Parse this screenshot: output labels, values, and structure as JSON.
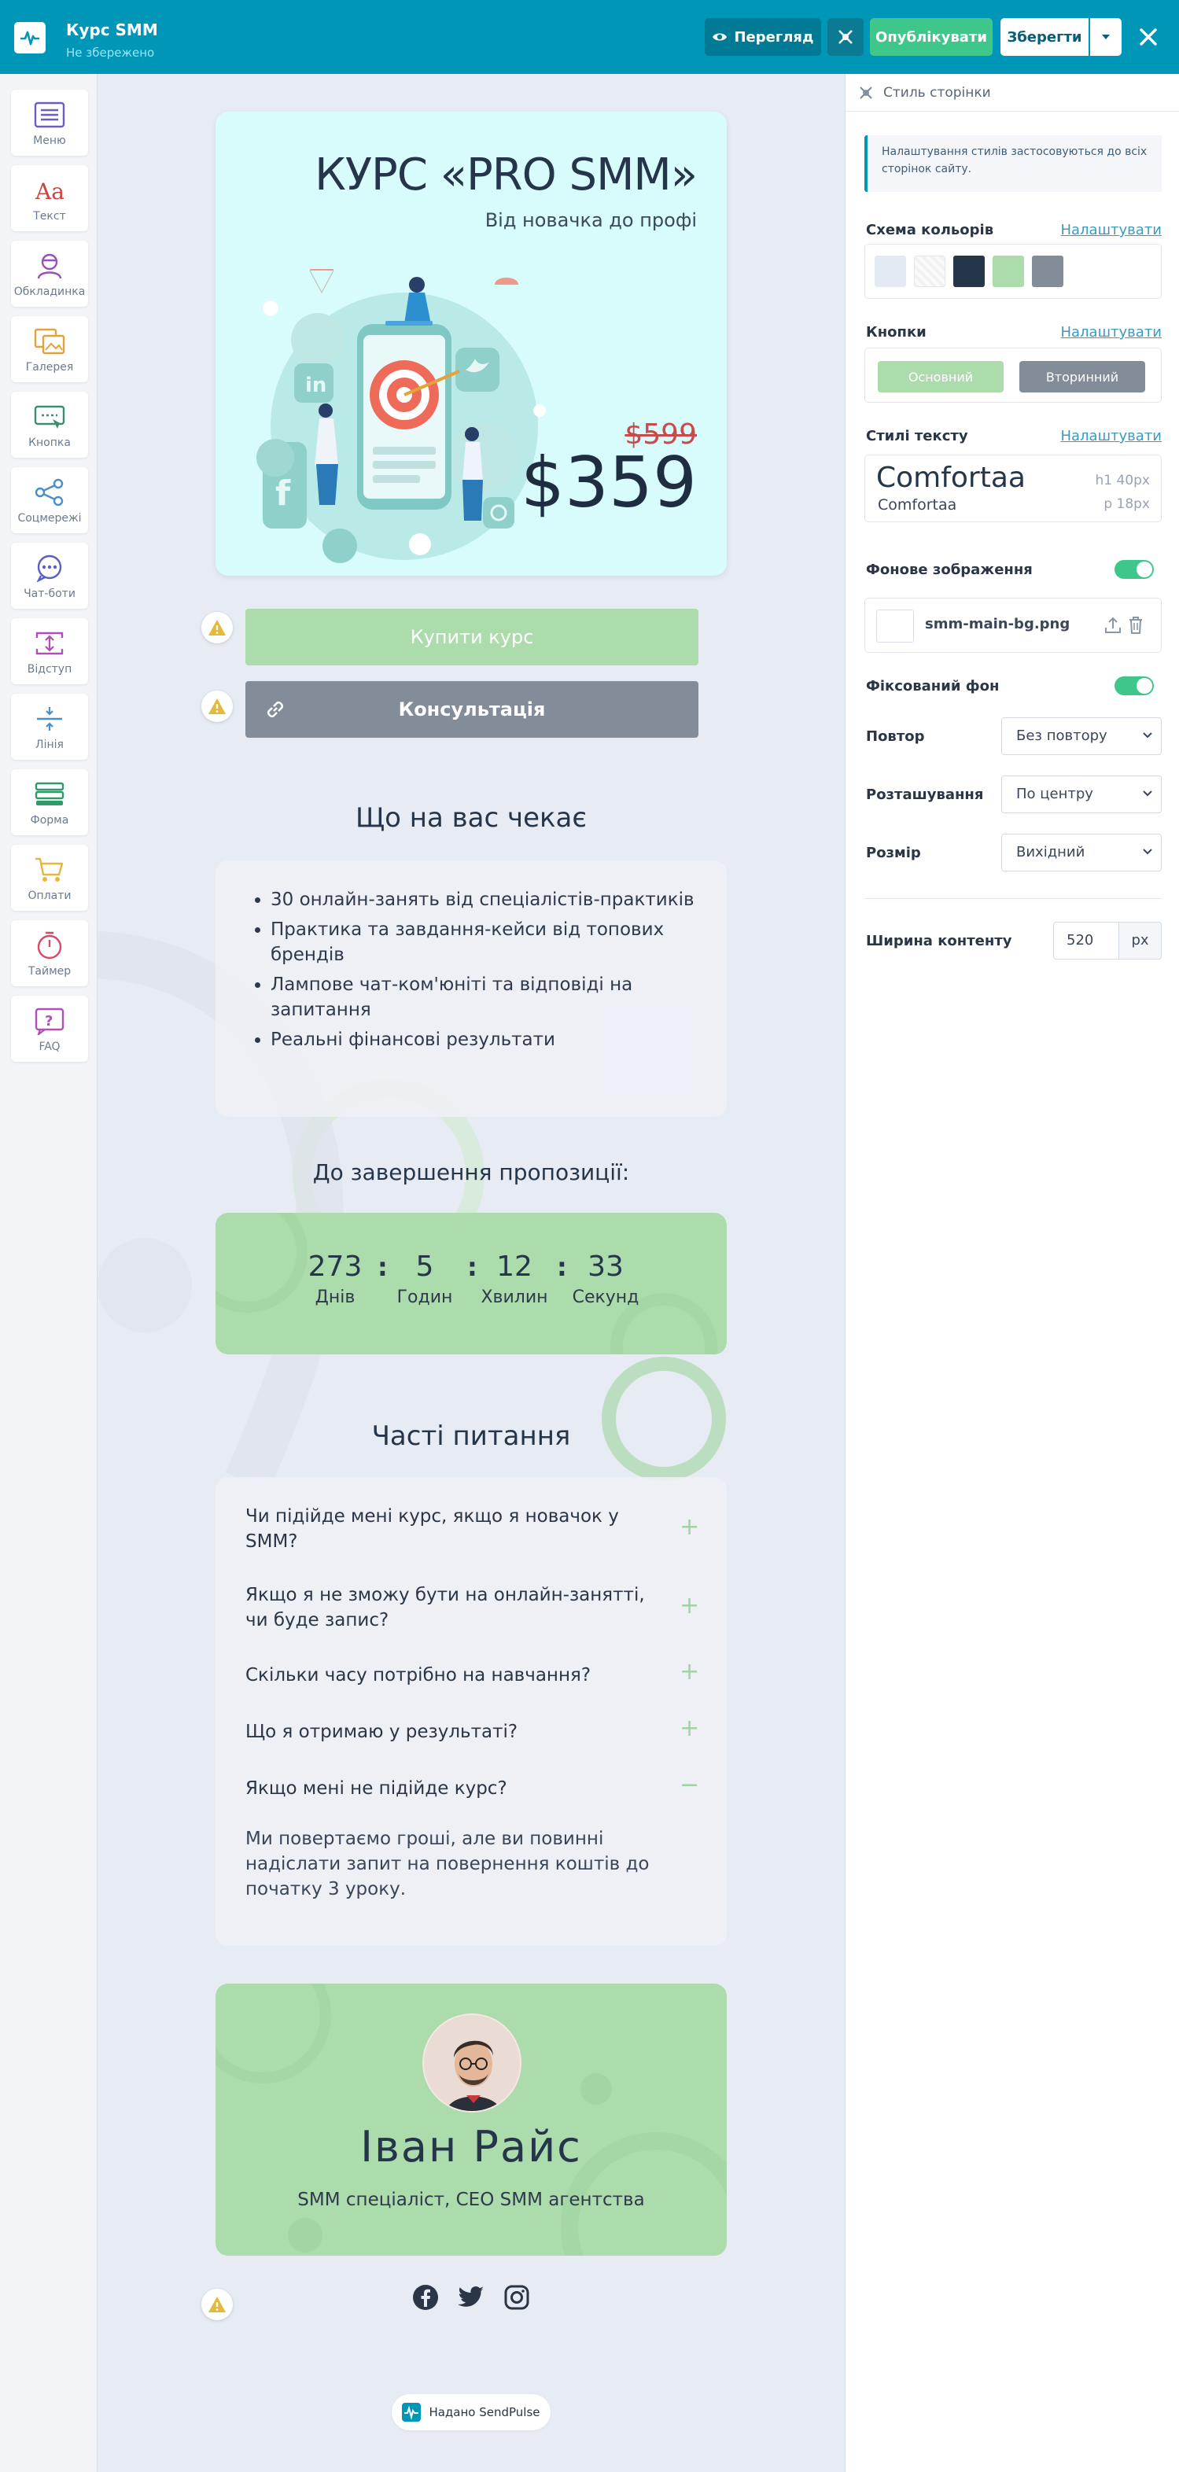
{
  "header": {
    "app_title": "Курс SMM",
    "save_status": "Не збережено",
    "preview_label": "Перегляд",
    "publish_label": "Опублікувати",
    "save_label": "Зберегти",
    "colors": {
      "bar": "#0096b7",
      "publish": "#3fc78b"
    }
  },
  "toolbox": {
    "items": [
      {
        "label": "Меню",
        "icon": "menu-icon"
      },
      {
        "label": "Текст",
        "icon": "text-icon"
      },
      {
        "label": "Обкладинка",
        "icon": "cover-icon"
      },
      {
        "label": "Галерея",
        "icon": "gallery-icon"
      },
      {
        "label": "Кнопка",
        "icon": "button-icon"
      },
      {
        "label": "Соцмережі",
        "icon": "share-icon"
      },
      {
        "label": "Чат-боти",
        "icon": "chat-icon"
      },
      {
        "label": "Відступ",
        "icon": "spacing-icon"
      },
      {
        "label": "Лінія",
        "icon": "line-icon"
      },
      {
        "label": "Форма",
        "icon": "form-icon"
      },
      {
        "label": "Оплати",
        "icon": "cart-icon"
      },
      {
        "label": "Таймер",
        "icon": "timer-icon"
      },
      {
        "label": "FAQ",
        "icon": "faq-icon"
      }
    ]
  },
  "canvas": {
    "hero": {
      "title": "КУРС «PRO SMM»",
      "subtitle": "Від новачка до профі",
      "old_price": "$599",
      "new_price": "$359"
    },
    "buttons": {
      "buy": "Купити курс",
      "consult": "Консультація"
    },
    "what_awaits": {
      "heading": "Що на вас чекає",
      "items": [
        "30 онлайн-занять від спеціалістів-практиків",
        "Практика та завдання-кейси від топових брендів",
        "Лампове чат-ком'юніті та відповіді на запитання",
        "Реальні фінансові результати"
      ]
    },
    "timer": {
      "heading": "До завершення пропозиції:",
      "days": "273",
      "days_label": "Днів",
      "hours": "5",
      "hours_label": "Годин",
      "minutes": "12",
      "minutes_label": "Хвилин",
      "seconds": "33",
      "seconds_label": "Секунд"
    },
    "faq": {
      "heading": "Часті питання",
      "items": [
        {
          "q": "Чи підійде мені курс, якщо я новачок у SMM?",
          "open": false
        },
        {
          "q": "Якщо я не зможу бути на онлайн-занятті, чи буде запис?",
          "open": false
        },
        {
          "q": "Скільки часу потрібно на навчання?",
          "open": false
        },
        {
          "q": "Що я отримаю у результаті?",
          "open": false
        },
        {
          "q": "Якщо мені не підійде курс?",
          "open": true
        }
      ],
      "answer": "Ми повертаємо гроші, але ви повинні надіслати запит на повернення коштів до початку 3 уроку."
    },
    "author": {
      "name": "Іван Райс",
      "role": "SMM спеціаліст, CEO SMM агентства"
    },
    "socials": [
      "facebook-icon",
      "twitter-icon",
      "instagram-icon"
    ],
    "footer": "Надано SendPulse"
  },
  "panel": {
    "title": "Стиль сторінки",
    "info": "Налаштування стилів застосовуються до всіх сторінок сайту.",
    "configure_label": "Налаштувати",
    "color_scheme": {
      "label": "Схема кольорів",
      "swatches": [
        "#e3eaf3",
        "#f2f2f2",
        "#25364a",
        "#acdbac",
        "#838d99"
      ]
    },
    "buttons": {
      "label": "Кнопки",
      "primary": "Основний",
      "secondary": "Вторинний"
    },
    "text_styles": {
      "label": "Стилі тексту",
      "heading_font": "Comfortaa",
      "body_font": "Comfortaa",
      "h1": "h1  40px",
      "p": "p  18px"
    },
    "bg_image": {
      "label": "Фонове зображення",
      "enabled": true,
      "file": "smm-main-bg.png"
    },
    "fixed_bg": {
      "label": "Фіксований фон",
      "enabled": true
    },
    "repeat": {
      "label": "Повтор",
      "value": "Без повтору"
    },
    "position": {
      "label": "Розташування",
      "value": "По центру"
    },
    "size": {
      "label": "Розмір",
      "value": "Вихідний"
    },
    "content_width": {
      "label": "Ширина контенту",
      "value": "520",
      "unit": "px"
    }
  }
}
